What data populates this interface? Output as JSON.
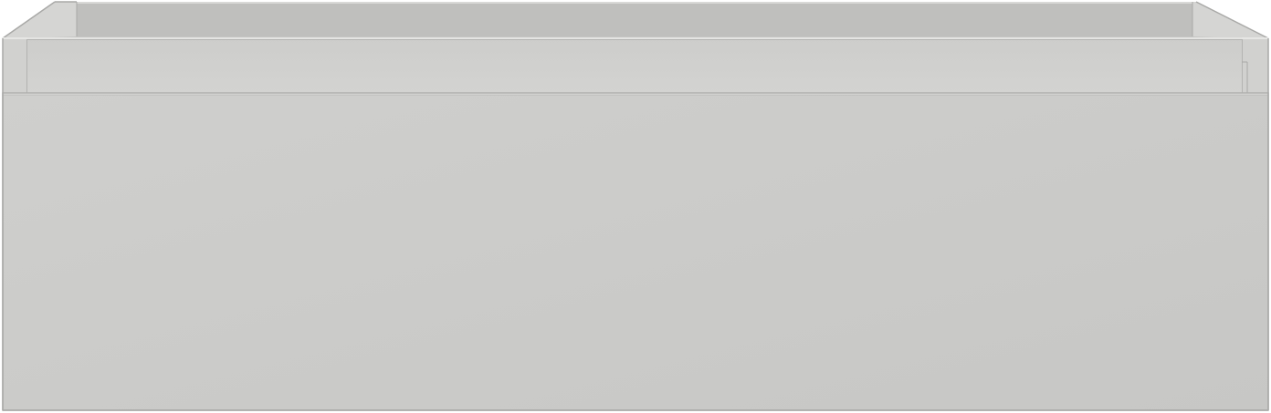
{
  "colors": {
    "background": "#ffffff",
    "front_panel": "#cbcbc9",
    "front_panel_edge": "#d6d6d4",
    "interior_back": "#bdbdbb",
    "interior_floor": "#b3b3b1",
    "inner_rim": "#cdcdcb",
    "side_wall": "#d2d2d0",
    "highlight": "#e6e6e4",
    "shadow_line": "#a9a9a7",
    "outline": "#b0b0ae"
  },
  "object": {
    "kind": "drawer",
    "state": "open",
    "handle": "none"
  }
}
